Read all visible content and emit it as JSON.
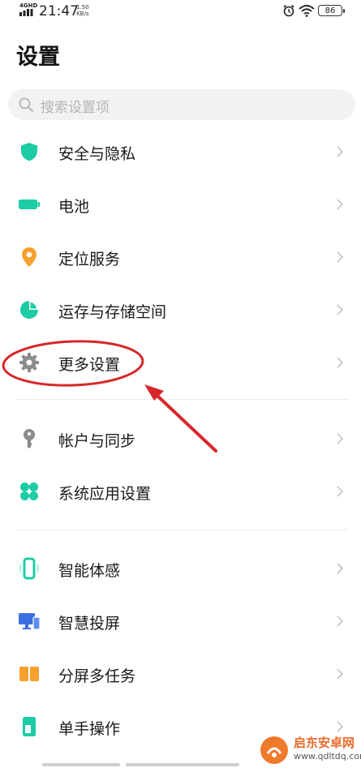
{
  "status_bar": {
    "network": "4GHD",
    "time": "21:47",
    "speed_value": "1.50",
    "speed_unit": "KB/s",
    "battery": "86"
  },
  "page": {
    "title": "设置"
  },
  "search": {
    "placeholder": "搜索设置项"
  },
  "items": [
    {
      "label": "安全与隐私",
      "icon": "shield-icon",
      "color": "#1ccca4"
    },
    {
      "label": "电池",
      "icon": "battery-icon",
      "color": "#1ccca4"
    },
    {
      "label": "定位服务",
      "icon": "location-pin-icon",
      "color": "#f6a12d"
    },
    {
      "label": "运存与存储空间",
      "icon": "pie-chart-icon",
      "color": "#1ccca4"
    },
    {
      "label": "更多设置",
      "icon": "gear-icon",
      "color": "#8b8b8b"
    },
    {
      "label": "帐户与同步",
      "icon": "key-icon",
      "color": "#8b8b8b"
    },
    {
      "label": "系统应用设置",
      "icon": "clover-icon",
      "color": "#1ccca4"
    },
    {
      "label": "智能体感",
      "icon": "phone-motion-icon",
      "color": "#1ccca4"
    },
    {
      "label": "智慧投屏",
      "icon": "cast-screen-icon",
      "color": "#3b6fe0"
    },
    {
      "label": "分屏多任务",
      "icon": "split-screen-icon",
      "color": "#f6a12d"
    },
    {
      "label": "单手操作",
      "icon": "one-hand-icon",
      "color": "#1ccca4"
    }
  ],
  "annotation": {
    "highlight_color": "#d8272a"
  },
  "watermark": {
    "name": "启东安卓网",
    "url": "www.qdltdq.com"
  }
}
